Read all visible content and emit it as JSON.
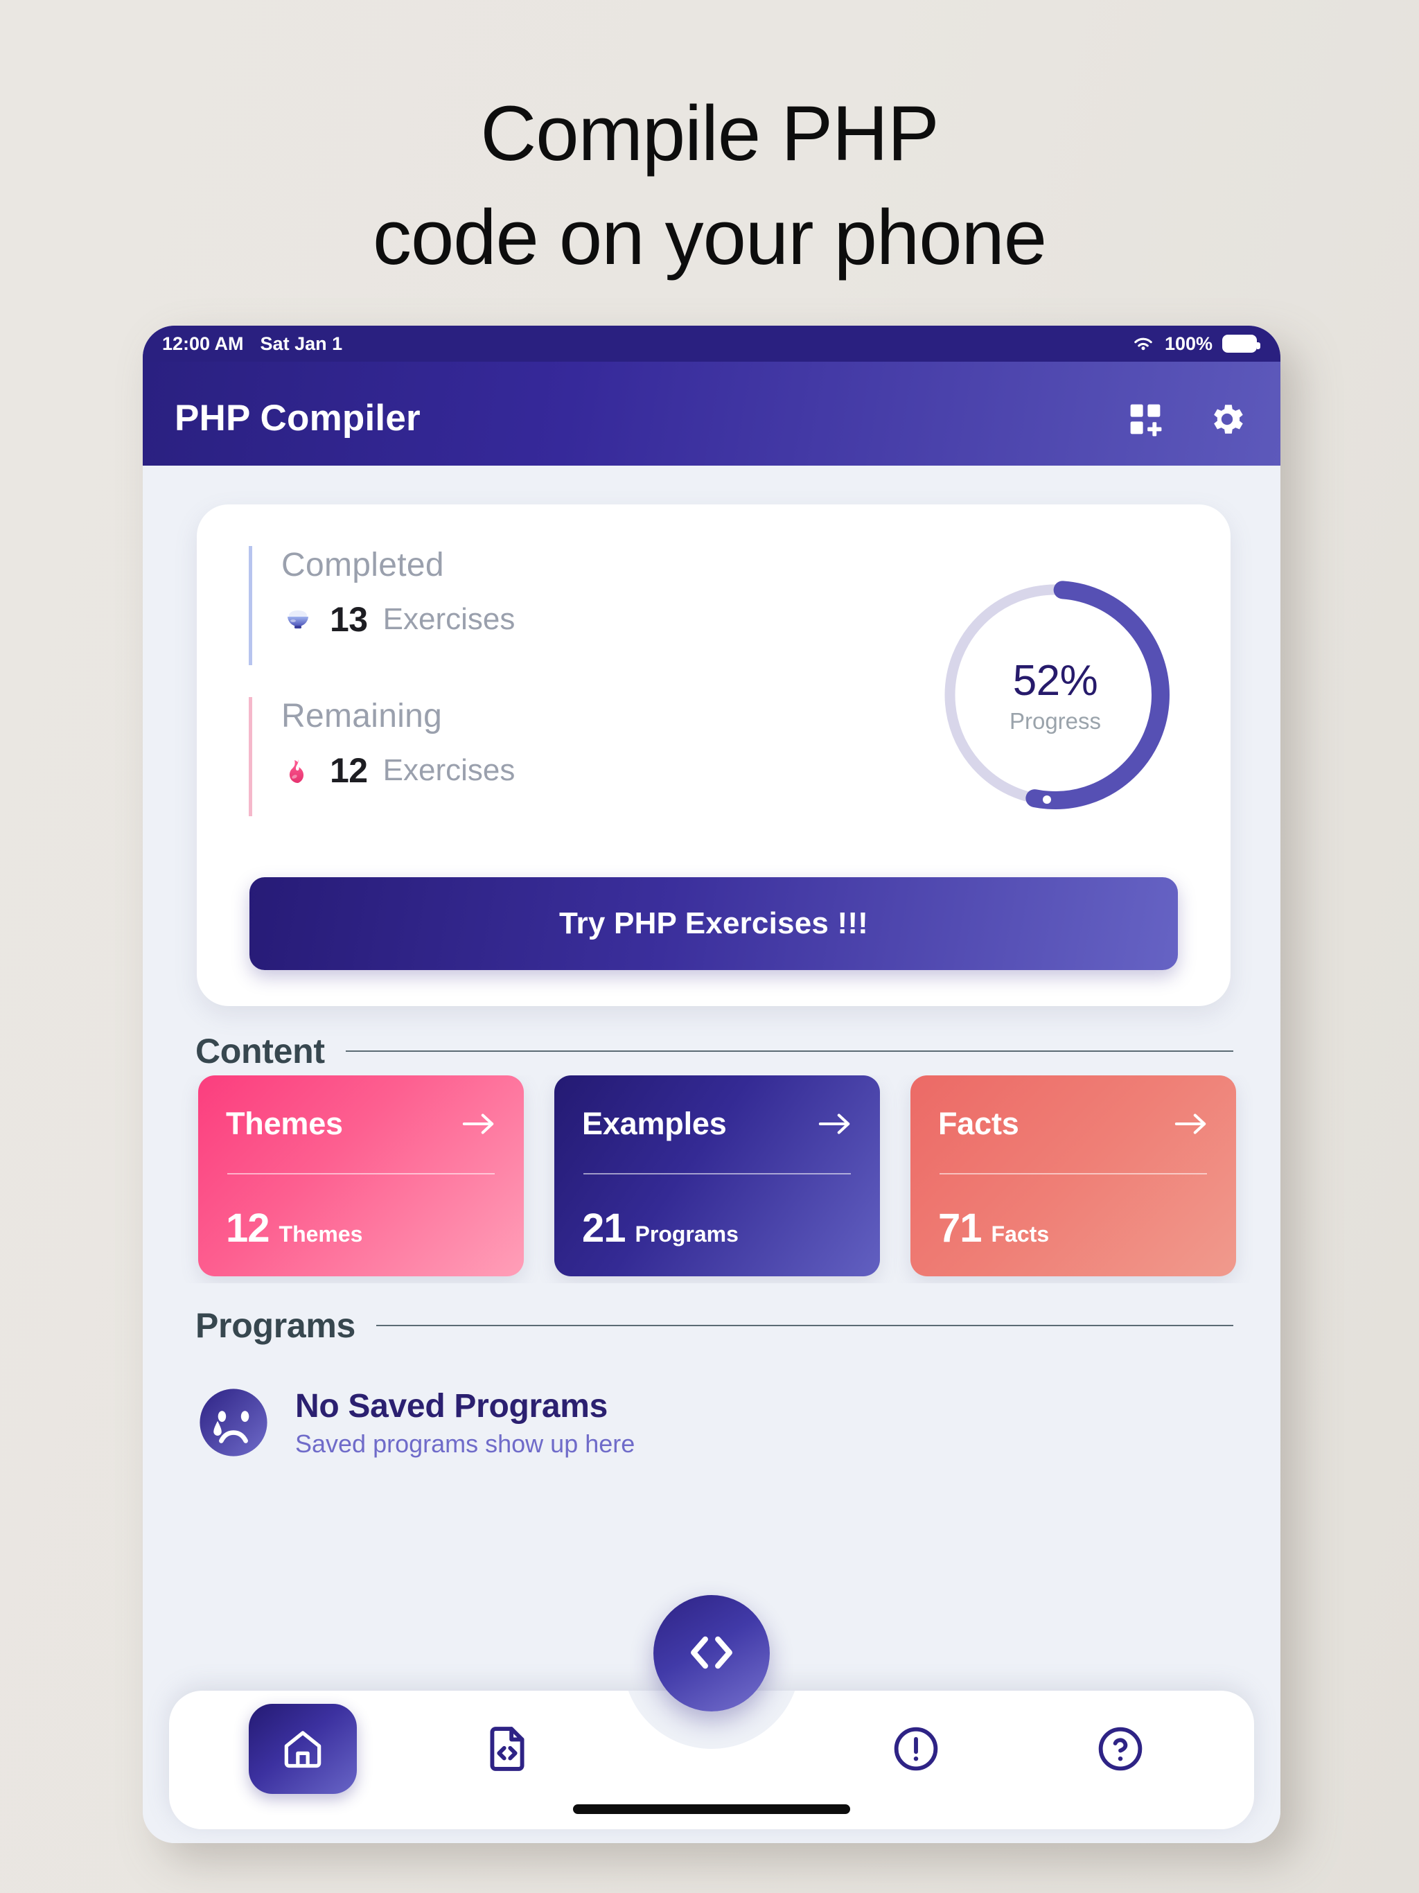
{
  "promo": {
    "headline_line1": "Compile PHP",
    "headline_line2": "code on your phone"
  },
  "statusbar": {
    "time": "12:00 AM",
    "date": "Sat Jan 1",
    "battery_percent": "100%",
    "wifi_icon": "wifi-icon",
    "battery_icon": "battery-full-icon"
  },
  "appbar": {
    "title": "PHP Compiler",
    "widget_icon": "add-widget-icon",
    "settings_icon": "gear-icon"
  },
  "progress_card": {
    "completed": {
      "label": "Completed",
      "emoji": "rice-bowl-icon",
      "count": "13",
      "unit": "Exercises"
    },
    "remaining": {
      "label": "Remaining",
      "emoji": "flame-icon",
      "count": "12",
      "unit": "Exercises"
    },
    "ring": {
      "percent_label": "52%",
      "percent_value": 52,
      "caption": "Progress",
      "track_color": "#d8d6ea",
      "arc_color": "#5650b4"
    },
    "cta_label": "Try PHP Exercises !!!"
  },
  "content_section": {
    "title": "Content",
    "cards": [
      {
        "title": "Themes",
        "count": "12",
        "unit": "Themes",
        "arrow_icon": "arrow-right-icon",
        "color": "#fb3e7e"
      },
      {
        "title": "Examples",
        "count": "21",
        "unit": "Programs",
        "arrow_icon": "arrow-right-icon",
        "color": "#241a73"
      },
      {
        "title": "Facts",
        "count": "71",
        "unit": "Facts",
        "arrow_icon": "arrow-right-icon",
        "color": "#ec6a66"
      }
    ]
  },
  "programs_section": {
    "title": "Programs",
    "empty_emoji": "crying-face-icon",
    "empty_title": "No Saved Programs",
    "empty_subtitle": "Saved programs show up here"
  },
  "bottom_nav": {
    "items": [
      {
        "name": "home",
        "icon": "home-icon",
        "active": true
      },
      {
        "name": "files",
        "icon": "file-code-icon",
        "active": false
      },
      {
        "name": "about",
        "icon": "exclamation-circle-icon",
        "active": false
      },
      {
        "name": "help",
        "icon": "question-circle-icon",
        "active": false
      }
    ],
    "fab_icon": "code-brackets-icon"
  }
}
